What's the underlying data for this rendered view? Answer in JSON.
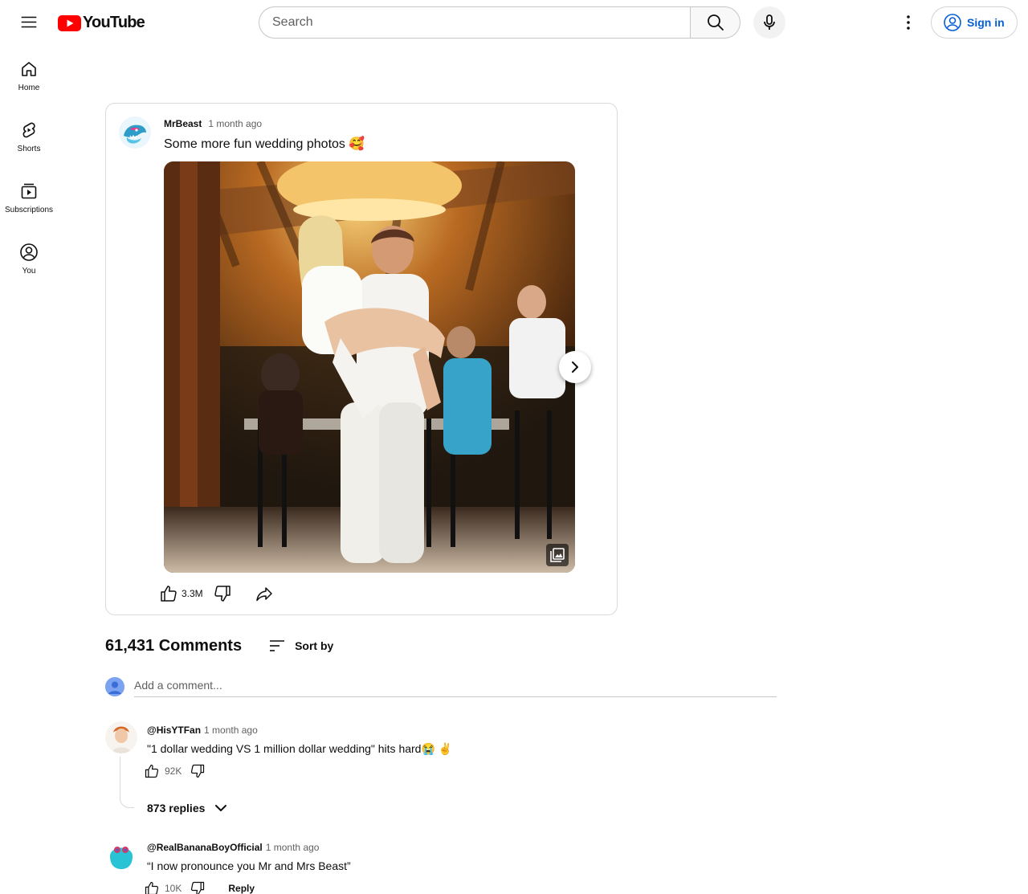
{
  "header": {
    "logo_text": "YouTube",
    "search_placeholder": "Search",
    "signin_label": "Sign in"
  },
  "sidebar": {
    "items": [
      {
        "label": "Home",
        "icon": "home-icon"
      },
      {
        "label": "Shorts",
        "icon": "shorts-icon"
      },
      {
        "label": "Subscriptions",
        "icon": "subscriptions-icon"
      },
      {
        "label": "You",
        "icon": "you-icon"
      }
    ]
  },
  "post": {
    "channel": "MrBeast",
    "time": "1 month ago",
    "text": "Some more fun wedding photos 🥰",
    "likes": "3.3M",
    "image_alt": "wedding photo"
  },
  "comments": {
    "count_label": "61,431 Comments",
    "sort_label": "Sort by",
    "add_placeholder": "Add a comment...",
    "items": [
      {
        "author": "@HisYTFan",
        "time": "1 month ago",
        "text": "\"1 dollar wedding VS 1 million dollar wedding\" hits hard😭 ✌️",
        "likes": "92K",
        "replies_label": "873 replies"
      },
      {
        "author": "@RealBananaBoyOfficial",
        "time": "1 month ago",
        "text": "“I now pronounce you Mr and Mrs Beast”",
        "likes": "10K",
        "reply_label": "Reply"
      }
    ]
  },
  "colors": {
    "brand_red": "#ff0000",
    "link_blue": "#065fd4",
    "text_primary": "#0f0f0f",
    "text_secondary": "#606060"
  }
}
